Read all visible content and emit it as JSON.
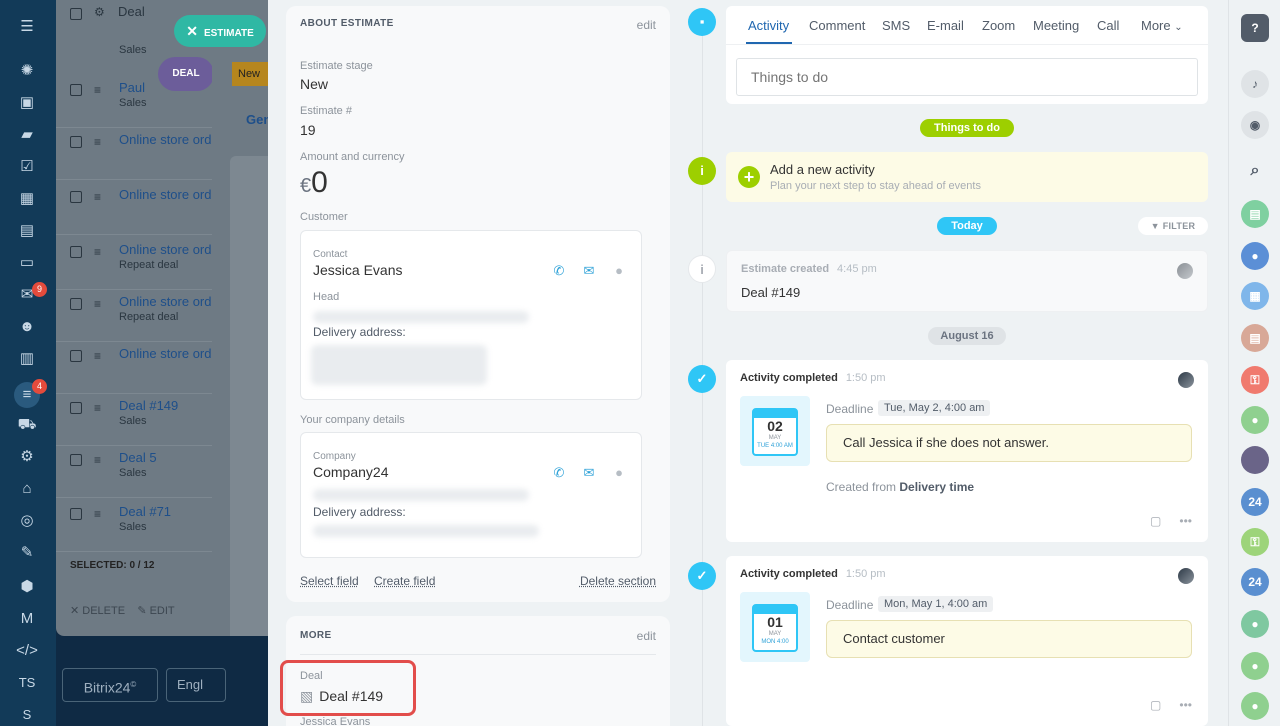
{
  "left_sidebar": {
    "badges": [
      "9",
      "4"
    ],
    "bottom_text": [
      "TS",
      "S"
    ]
  },
  "background_list": {
    "header_label": "Deal",
    "rows": [
      {
        "title": "Paul",
        "sub": "Sales"
      },
      {
        "title": "Online store ord",
        "sub": ""
      },
      {
        "title": "Online store ord",
        "sub": ""
      },
      {
        "title": "Online store ord",
        "sub": "Repeat deal"
      },
      {
        "title": "Online store ord",
        "sub": "Repeat deal"
      },
      {
        "title": "Online store ord",
        "sub": ""
      },
      {
        "title": "Deal #149",
        "sub": "Sales"
      },
      {
        "title": "Deal 5",
        "sub": "Sales"
      },
      {
        "title": "Deal #71",
        "sub": "Sales"
      }
    ],
    "top_sub": "Sales",
    "selected_label": "SELECTED: 0 / 12",
    "delete_label": "DELETE",
    "edit_label": "EDIT",
    "estimate_pill": "ESTIMATE",
    "deal_pill": "DEAL",
    "new_tag": "New",
    "general_tab": "Gen",
    "brand": "Bitrix24",
    "brand_reg": "©",
    "lang": "Engl"
  },
  "about": {
    "header": "ABOUT ESTIMATE",
    "edit": "edit",
    "stage_label": "Estimate stage",
    "stage_value": "New",
    "number_label": "Estimate #",
    "number_value": "19",
    "amount_label": "Amount and currency",
    "currency_symbol": "€",
    "amount_value": "0",
    "customer_label": "Customer",
    "contact": {
      "label": "Contact",
      "name": "Jessica Evans",
      "role": "Head",
      "address_label": "Delivery address:"
    },
    "company_section_label": "Your company details",
    "company": {
      "label": "Company",
      "name": "Company24",
      "address_label": "Delivery address:"
    },
    "select_field": "Select field",
    "create_field": "Create field",
    "delete_section": "Delete section"
  },
  "more": {
    "header": "MORE",
    "edit": "edit",
    "deal_label": "Deal",
    "deal_value": "Deal #149",
    "deal_sub": "Jessica Evans"
  },
  "timeline": {
    "tabs": [
      "Activity",
      "Comment",
      "SMS",
      "E-mail",
      "Zoom",
      "Meeting",
      "Call",
      "More"
    ],
    "todo_placeholder": "Things to do",
    "things_to_do_pill": "Things to do",
    "new_activity_title": "Add a new activity",
    "new_activity_sub": "Plan your next step to stay ahead of events",
    "today_pill": "Today",
    "filter_label": "FILTER",
    "estimate_created": {
      "title": "Estimate created",
      "time": "4:45 pm",
      "body": "Deal #149"
    },
    "august_pill": "August 16",
    "activities": [
      {
        "title": "Activity completed",
        "time": "1:50 pm",
        "cal_day": "02",
        "cal_month": "MAY",
        "cal_time": "TUE 4:00 AM",
        "deadline_label": "Deadline",
        "deadline_value": "Tue, May 2, 4:00 am",
        "note": "Call Jessica if she does not answer.",
        "created_from_label": "Created from",
        "created_from_value": "Delivery time"
      },
      {
        "title": "Activity completed",
        "time": "1:50 pm",
        "cal_day": "01",
        "cal_month": "MAY",
        "cal_time": "MON 4:00",
        "deadline_label": "Deadline",
        "deadline_value": "Mon, May 1, 4:00 am",
        "note": "Contact customer"
      }
    ]
  },
  "right_bar": {
    "help": "?",
    "counters": [
      "24",
      "24"
    ]
  },
  "colors": {
    "accent_blue": "#2fc6f6",
    "accent_green": "#9dcf00",
    "link_blue": "#2067b0",
    "highlight_red": "#e24d4b"
  }
}
